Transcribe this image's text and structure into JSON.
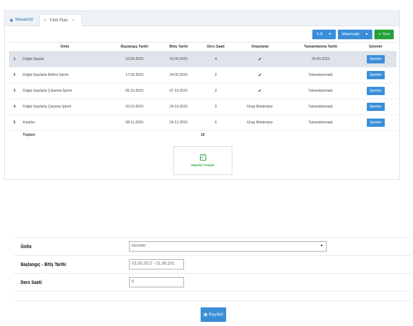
{
  "tabs": {
    "home_label": "Masaüstü",
    "active_label": "Yıllık Plan"
  },
  "toolbar": {
    "class_select": "5-A",
    "subject_select": "Matematik",
    "new_label": "Yeni"
  },
  "table": {
    "headers": [
      "",
      "Ünite",
      "Başlangıç Tarihi",
      "Bitiş Tarihi",
      "Ders Saati",
      "Onaylandı",
      "Tamamlanma Tarihi",
      "İşlemler"
    ],
    "rows": [
      {
        "num": "1",
        "unit": "Doğal Sayılar",
        "start": "10.09.2015",
        "end": "16.09.2015",
        "hours": "4",
        "approved": "✔",
        "completed": "24.09.2015",
        "action": "İşlemler"
      },
      {
        "num": "2",
        "unit": "Doğal Sayılarla Bölme İşlemi",
        "start": "17.09.2015",
        "end": "24.09.2015",
        "hours": "2",
        "approved": "✔",
        "completed": "Tamamlanmadı",
        "action": "İşlemler"
      },
      {
        "num": "3",
        "unit": "Doğal Sayılarla Çıkarma İşlemi",
        "start": "05.10.2015",
        "end": "07.10.2015",
        "hours": "3",
        "approved": "✔",
        "completed": "Tamamlanmadı",
        "action": "İşlemler"
      },
      {
        "num": "4",
        "unit": "Doğal Sayılarla Çarpma İşlemi",
        "start": "20.10.2015",
        "end": "24.10.2015",
        "hours": "3",
        "approved": "Onay Bekleniyor",
        "completed": "Tamamlanmadı",
        "action": "İşlemler"
      },
      {
        "num": "5",
        "unit": "Kesirler",
        "start": "08.11.2016",
        "end": "24.12.2016",
        "hours": "6",
        "approved": "Onay Bekleniyor",
        "completed": "Tamamlanmadı",
        "action": "İşlemler"
      }
    ],
    "total_label": "Toplam",
    "total_hours": "18"
  },
  "approve_all_label": "Hepsini Onayla",
  "form": {
    "unit_label": "Ünite",
    "unit_value": "Kesirler",
    "dates_label": "Başlangıç - Bitiş Tarihi",
    "dates_value": "03.05.2017 - 01.06.201",
    "hours_label": "Ders Saati",
    "hours_value": "6",
    "save_label": "Kaydet"
  }
}
